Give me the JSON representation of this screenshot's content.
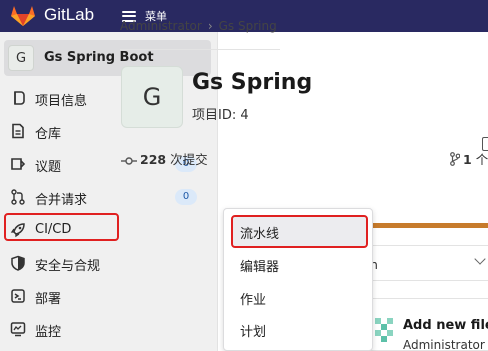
{
  "topbar": {
    "brand": "GitLab",
    "menu_label": "菜单"
  },
  "sidebar": {
    "project_avatar": "G",
    "project_name": "Gs Spring Boot",
    "items": [
      {
        "label": "项目信息",
        "icon": "info-icon"
      },
      {
        "label": "仓库",
        "icon": "document-icon"
      },
      {
        "label": "议题",
        "icon": "issues-icon",
        "badge": "0"
      },
      {
        "label": "合并请求",
        "icon": "merge-request-icon",
        "badge": "0"
      },
      {
        "label": "CI/CD",
        "icon": "rocket-icon"
      },
      {
        "label": "安全与合规",
        "icon": "shield-icon"
      },
      {
        "label": "部署",
        "icon": "deploy-icon"
      },
      {
        "label": "监控",
        "icon": "monitor-icon"
      }
    ]
  },
  "breadcrumb": {
    "root": "Administrator",
    "current": "Gs Spring"
  },
  "project": {
    "avatar": "G",
    "title": "Gs Spring",
    "id_text": "项目ID: 4",
    "commits_count": "228",
    "commits_label": "次提交",
    "branches_count": "1",
    "branches_label": "个"
  },
  "dropdown": {
    "text": "n"
  },
  "commit": {
    "title": "Add new file",
    "author": "Administrator"
  },
  "popup": {
    "items": [
      "流水线",
      "编辑器",
      "作业",
      "计划"
    ]
  },
  "colors": {
    "topbar": "#292961",
    "highlight": "#e02020",
    "badge_bg": "#dbe9f9",
    "lang_bar": "#c77b2c"
  }
}
